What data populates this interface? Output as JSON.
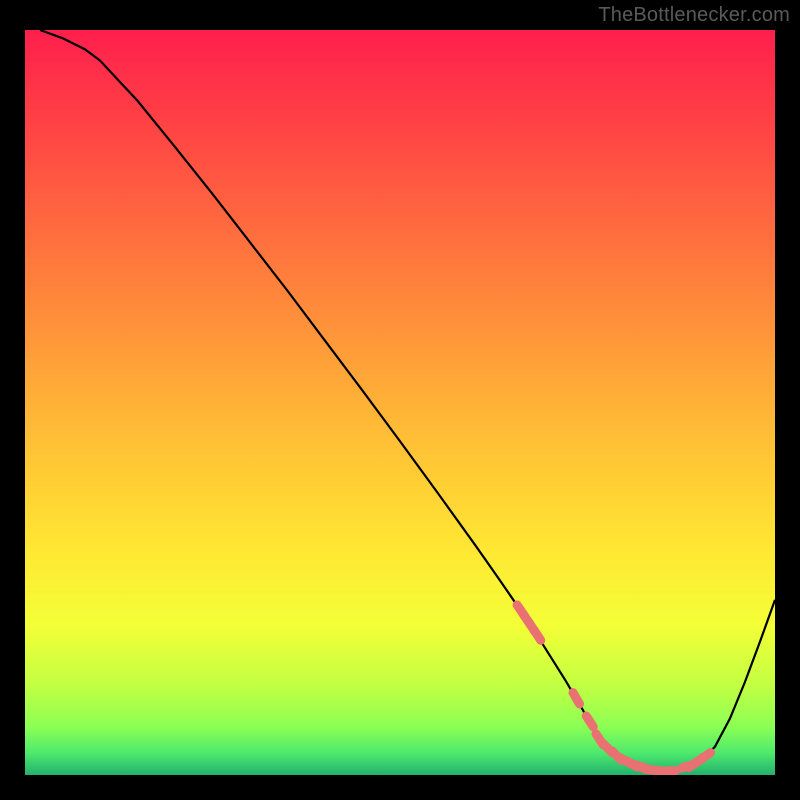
{
  "attribution": "TheBottlenecker.com",
  "chart_data": {
    "type": "line",
    "title": "",
    "xlabel": "",
    "ylabel": "",
    "xlim": [
      0,
      100
    ],
    "ylim": [
      0,
      100
    ],
    "series": [
      {
        "name": "curve",
        "x": [
          2,
          5,
          8,
          10,
          15,
          20,
          25,
          30,
          35,
          40,
          45,
          50,
          55,
          60,
          63,
          66,
          68,
          70,
          72,
          74,
          76,
          78,
          80,
          82,
          84,
          86,
          88,
          90,
          92,
          94,
          96,
          98,
          100
        ],
        "y": [
          100,
          98.9,
          97.4,
          95.9,
          90.5,
          84.3,
          78.0,
          71.5,
          65.0,
          58.3,
          51.6,
          44.8,
          37.9,
          30.9,
          26.6,
          22.2,
          19.2,
          16.0,
          12.8,
          9.4,
          5.8,
          3.2,
          1.7,
          0.9,
          0.5,
          0.5,
          0.9,
          1.8,
          3.8,
          7.6,
          12.5,
          17.9,
          23.5
        ]
      },
      {
        "name": "markers",
        "x": [
          66.1,
          66.9,
          67.5,
          68.3,
          73.5,
          75.3,
          76.6,
          77.7,
          78.9,
          79.9,
          80.9,
          81.9,
          82.6,
          83.5,
          84.3,
          85.1,
          85.9,
          88.4,
          89.2,
          89.8,
          90.7
        ],
        "y": [
          22.1,
          20.9,
          20.0,
          18.8,
          10.3,
          7.2,
          4.8,
          3.6,
          2.6,
          2.0,
          1.5,
          1.2,
          0.9,
          0.7,
          0.6,
          0.5,
          0.5,
          1.2,
          1.5,
          1.9,
          2.5
        ]
      }
    ],
    "gradient_stops": [
      {
        "offset": 0.0,
        "color": "#ff1f4c"
      },
      {
        "offset": 0.14,
        "color": "#ff4644"
      },
      {
        "offset": 0.28,
        "color": "#ff6f3e"
      },
      {
        "offset": 0.42,
        "color": "#ff9939"
      },
      {
        "offset": 0.56,
        "color": "#ffc235"
      },
      {
        "offset": 0.7,
        "color": "#ffe833"
      },
      {
        "offset": 0.8,
        "color": "#f3ff36"
      },
      {
        "offset": 0.88,
        "color": "#c2ff42"
      },
      {
        "offset": 0.935,
        "color": "#8cff54"
      },
      {
        "offset": 0.97,
        "color": "#4eea6c"
      },
      {
        "offset": 1.0,
        "color": "#23b06e"
      }
    ],
    "marker_color": "#e97171",
    "curve_color": "#000000"
  }
}
